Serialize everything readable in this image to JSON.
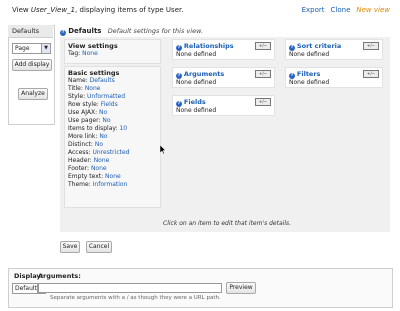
{
  "header": {
    "prefix": "View",
    "view_name": "User_View_1",
    "suffix": ", displaying items of type User.",
    "links": {
      "export": "Export",
      "clone": "Clone",
      "new_view": "New view"
    }
  },
  "displays": {
    "tab_label": "Defaults",
    "select_value": "Page",
    "add_display_label": "Add display",
    "analyze_label": "Analyze"
  },
  "defaults": {
    "title": "Defaults",
    "description": "Default settings for this view."
  },
  "view_settings": {
    "title": "View settings",
    "tag_label": "Tag:",
    "tag_value": "None"
  },
  "basic_settings": {
    "title": "Basic settings",
    "rows": [
      {
        "label": "Name:",
        "value": "Defaults"
      },
      {
        "label": "Title:",
        "value": "None"
      },
      {
        "label": "Style:",
        "value": "Unformatted"
      },
      {
        "label": "Row style:",
        "value": "Fields"
      },
      {
        "label": "Use AJAX:",
        "value": "No"
      },
      {
        "label": "Use pager:",
        "value": "No"
      },
      {
        "label": "Items to display:",
        "value": "10"
      },
      {
        "label": "More link:",
        "value": "No"
      },
      {
        "label": "Distinct:",
        "value": "No"
      },
      {
        "label": "Access:",
        "value": "Unrestricted"
      },
      {
        "label": "Header:",
        "value": "None"
      },
      {
        "label": "Footer:",
        "value": "None"
      },
      {
        "label": "Empty text:",
        "value": "None"
      },
      {
        "label": "Theme:",
        "value": "Information"
      }
    ]
  },
  "sections": {
    "relationships": {
      "title": "Relationships",
      "value": "None defined",
      "button": "+/−"
    },
    "arguments": {
      "title": "Arguments",
      "value": "None defined",
      "button": "+/−"
    },
    "fields": {
      "title": "Fields",
      "value": "None defined",
      "button": "+/−"
    },
    "sort_criteria": {
      "title": "Sort criteria",
      "value": "None defined",
      "button": "+/−"
    },
    "filters": {
      "title": "Filters",
      "value": "None defined",
      "button": "+/−"
    }
  },
  "footer_note": "Click on an item to edit that item's details.",
  "actions": {
    "save": "Save",
    "cancel": "Cancel"
  },
  "preview": {
    "display_label": "Display:",
    "arguments_label": "Arguments:",
    "display_value": "Defaults",
    "arguments_value": "",
    "preview_button": "Preview",
    "help_text": "Separate arguments with a / as though they were a URL path."
  },
  "colors": {
    "link": "#1b5fb4",
    "new_view": "#e08a00",
    "info_icon": "#2a66c7"
  }
}
